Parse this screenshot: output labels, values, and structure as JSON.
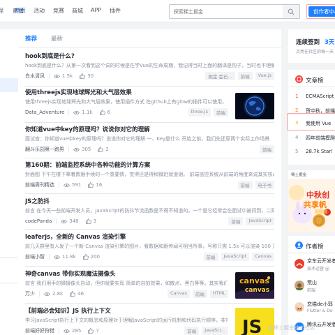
{
  "header": {
    "nav": [
      "程",
      "首页",
      "直播",
      "活动",
      "竞赛",
      "商城",
      "APP",
      "插件"
    ],
    "search_placeholder": "探索稀土掘金",
    "creator_button": "创作者中心"
  },
  "feed": {
    "tabs": [
      "推荐",
      "最新"
    ],
    "articles": [
      {
        "title": "hook到底是什么?",
        "summary": "hook到底是什么？从第一次看到这个词的时候是在学Vue的生命周期，我记得当时上面的翻译是钩子，当时也不理解",
        "author": "白水清风",
        "views": "1.5k",
        "likes": "30",
        "tags": [
          "掘金·金石...",
          "前端",
          "Vue.js"
        ]
      },
      {
        "title": "使用threejs实现地球辉光和大气层效果",
        "summary": "使用threejs实现地球辉光和大气层效果，使用插件方式 在github上有glow的插件可以使用，",
        "author": "Data_Adventure",
        "views": "1.1k",
        "likes": "6",
        "tags": [
          "three.js",
          "前端"
        ],
        "thumb": "earth"
      },
      {
        "title": "你知道vue中key的原理吗？说说你对它的理解",
        "summary": "面试官：你知道vue中key的原理吗？说说你对它的理解 一、Key是什么 开始之前，我们先还原两个实际工作场景",
        "author": "翻斗乐园第一跑男",
        "views": "305",
        "likes": "2",
        "tags": [
          "前端"
        ]
      },
      {
        "title": "第160期：前端监控系统中各种功能的计算方案",
        "summary": "封面图 下午在楼下拿着数据手续的一个重要情，觉得还是得稍微赶就道谢。 前端监控系统从前端的角度来说其实核心在于合",
        "author": "前端周刊精选",
        "views": "591",
        "likes": "16",
        "tags": [
          "前端",
          "电子书"
        ]
      },
      {
        "title": "JS之防抖",
        "summary": "前言 在今天一些前端开发人员，JavaScript的防抖节流函数是不得不知道的，一个是它经常会在面试中被问到，二则是",
        "author": "codePanda",
        "views": "348",
        "likes": "3",
        "tags": [
          "前端",
          "JavaScript"
        ]
      },
      {
        "title": "leaferjs，全新的 Canvas 渲染引擎",
        "summary": "前几天群里有人发了一个新 Canvas 渲染引擎的图片，看数据和跟传闻可相当所事，号称只需 1.5s 可以渲染 100 万矩形",
        "author": "前端小智",
        "views": "11.8k",
        "likes": "200",
        "tags": [
          "前端",
          "JavaScript",
          "Canvas"
        ]
      },
      {
        "title": "神奇canvas 带你实现魔法摄像头",
        "summary": "前言 我们用手的微摄像头自动，但你就要实现 简单的自拍效果，如散点、黑白等等。其实我们也可以实现！",
        "author": "万少",
        "views": "2.8k",
        "likes": "46",
        "tags": [
          "Canvas",
          "前端",
          "HTML"
        ],
        "thumb": "canvas"
      },
      {
        "title": "【前端必会知识】JS 执行上下文",
        "summary": "学习JavaScript执行上下文的概念和原理对于理解JavaScript的运行机制和代码执行顺序，非常有帮助",
        "author": "前端好好狩猎",
        "views": "285",
        "likes": "7",
        "tags": [
          "前端",
          "JavaScr..."
        ],
        "thumb": "js"
      }
    ]
  },
  "sidebar": {
    "checkin_title": "连续签到",
    "checkin_days": "3天",
    "checkin_sub": "点亮在社区的每一天",
    "articles_title": "文章榜",
    "articles": [
      {
        "rank": "1",
        "title": "ECMAScript"
      },
      {
        "rank": "2",
        "title": "贺中秋，前端"
      },
      {
        "rank": "3",
        "title": "我使用 Vue"
      },
      {
        "rank": "4",
        "title": "四年前端摸爬"
      },
      {
        "rank": "5",
        "title": "28.7k Star!"
      }
    ],
    "banner_lines": [
      "中秋创",
      "共享帆"
    ],
    "banner_top": "稀土掘金",
    "authors_title": "作者榜",
    "authors": [
      {
        "name": "京东云开发者",
        "desc": "技术运营 @"
      },
      {
        "name": "荒山",
        "desc": "前端"
      },
      {
        "name": "恋猫de小郭",
        "desc": "Flutter & De"
      },
      {
        "name": "腾讯云开发者",
        "desc": ""
      }
    ],
    "watermark": "@稀土掘金技术社区"
  },
  "colors": {
    "brand": "#1e80ff",
    "title": "#252933",
    "muted": "#8a919f",
    "rank_red": "#f53f3f",
    "rank_orange": "#ff7d00",
    "rank_gold": "#fba726"
  }
}
